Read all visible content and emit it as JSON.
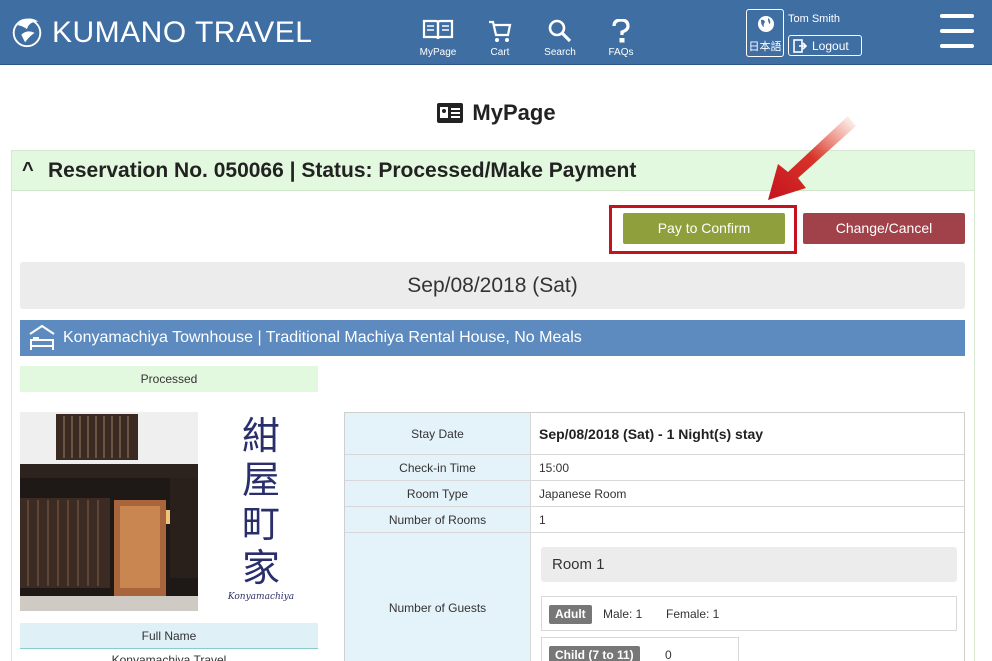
{
  "header": {
    "brand": "KUMANO TRAVEL",
    "nav": [
      {
        "label": "MyPage",
        "icon": "book-icon"
      },
      {
        "label": "Cart",
        "icon": "cart-icon"
      },
      {
        "label": "Search",
        "icon": "search-icon"
      },
      {
        "label": "FAQs",
        "icon": "question-icon"
      }
    ],
    "language_label": "日本語",
    "username": "Tom Smith",
    "logout_label": "Logout"
  },
  "page_title": "MyPage",
  "reservation": {
    "title": "Reservation No. 050066 | Status: Processed/Make Payment",
    "pay_label": "Pay to Confirm",
    "cancel_label": "Change/Cancel",
    "date": "Sep/08/2018 (Sat)",
    "property": "Konyamachiya Townhouse | Traditional Machiya Rental House, No Meals",
    "status": "Processed",
    "logo_kanji": [
      "紺",
      "屋",
      "町",
      "家"
    ],
    "logo_roman": "Konyamachiya",
    "fullname_label": "Full Name",
    "fullname_value": "Konyamachiya Travel",
    "details": {
      "stay_date_label": "Stay Date",
      "stay_date_value": "Sep/08/2018 (Sat)   -  1 Night(s) stay",
      "checkin_label": "Check-in Time",
      "checkin_value": "15:00",
      "room_type_label": "Room Type",
      "room_type_value": "Japanese Room",
      "rooms_label": "Number of Rooms",
      "rooms_value": "1",
      "guests_label": "Number of Guests",
      "room_name": "Room 1",
      "adult_tag": "Adult",
      "male": "Male:  1",
      "female": "Female:  1",
      "child_tag": "Child (7 to 11)",
      "child_value": "0"
    }
  },
  "colors": {
    "header": "#3f6ea3",
    "pay": "#8e9f3b",
    "cancel": "#a1424b",
    "highlight": "#c4131e",
    "property_bar": "#5d8bbf",
    "status_green": "#e3f9df"
  }
}
